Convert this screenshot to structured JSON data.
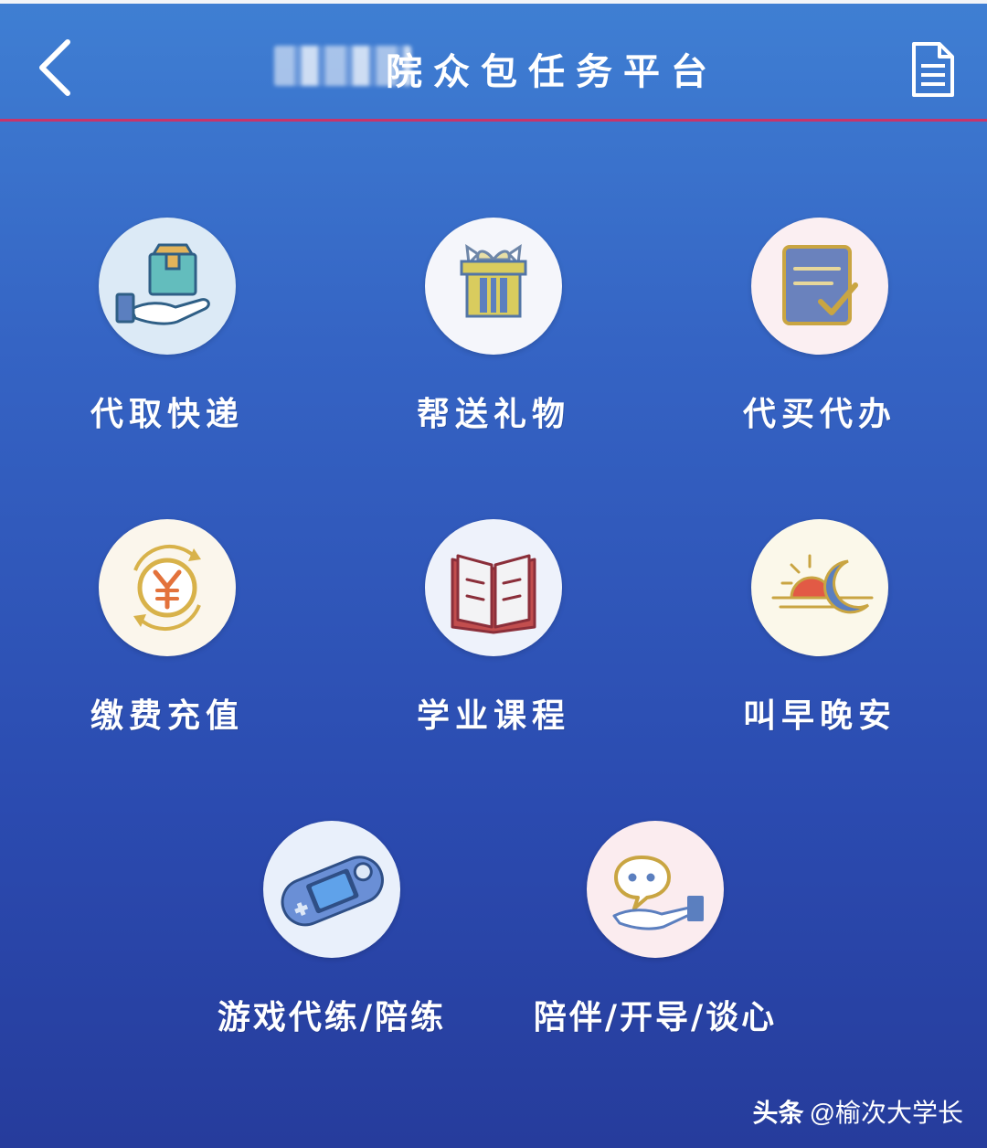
{
  "header": {
    "title": "院众包任务平台",
    "back_icon": "chevron-left-icon",
    "doc_icon": "document-icon"
  },
  "services": [
    {
      "label": "代取快递",
      "icon": "package-hand-icon",
      "bg": "#dceaf6"
    },
    {
      "label": "帮送礼物",
      "icon": "gift-box-icon",
      "bg": "#f5f6fb"
    },
    {
      "label": "代买代办",
      "icon": "checklist-icon",
      "bg": "#fbeff2"
    },
    {
      "label": "缴费充值",
      "icon": "yuan-coin-icon",
      "bg": "#fbf6ec"
    },
    {
      "label": "学业课程",
      "icon": "open-book-icon",
      "bg": "#eef2fb"
    },
    {
      "label": "叫早晚安",
      "icon": "sun-moon-icon",
      "bg": "#fbf8ea"
    },
    {
      "label": "游戏代练/陪练",
      "icon": "game-console-icon",
      "bg": "#e9f0fb"
    },
    {
      "label": "陪伴/开导/谈心",
      "icon": "chat-hand-icon",
      "bg": "#fbecef"
    }
  ],
  "watermark": {
    "brand": "头条",
    "handle": "@榆次大学长"
  }
}
